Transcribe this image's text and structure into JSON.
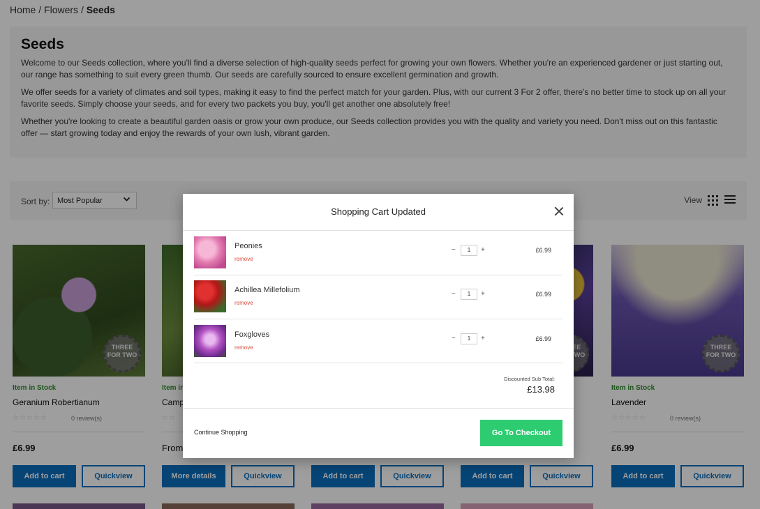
{
  "breadcrumb": {
    "home": "Home",
    "sep1": "/",
    "flowers": "Flowers",
    "sep2": "/",
    "current": "Seeds"
  },
  "intro": {
    "title": "Seeds",
    "paragraphs": [
      "Welcome to our Seeds collection, where you'll find a diverse selection of high-quality seeds perfect for growing your own flowers. Whether you're an experienced gardener or just starting out, our range has something to suit every green thumb. Our seeds are carefully sourced to ensure excellent germination and growth.",
      "We offer seeds for a variety of climates and soil types, making it easy to find the perfect match for your garden. Plus, with our current 3 For 2 offer, there's no better time to stock up on all your favorite seeds. Simply choose your seeds, and for every two packets you buy, you'll get another one absolutely free!",
      "Whether you're looking to create a beautiful garden oasis or grow your own produce, our Seeds collection provides you with the quality and variety you need. Don't miss out on this fantastic offer — start growing today and enjoy the rewards of your own lush, vibrant garden."
    ]
  },
  "toolbar": {
    "sort_label": "Sort by:",
    "sort_value": "Most Popular",
    "view_label": "View"
  },
  "products": [
    {
      "stock": "Item in Stock",
      "name": "Geranium Robertianum",
      "stars": "☆☆☆☆☆",
      "reviews": "0 review(s)",
      "price": "£6.99",
      "primary_btn": "Add to cart",
      "secondary_btn": "Quickview",
      "badge": "THREE FOR TWO"
    },
    {
      "stock": "Item in",
      "name": "Camp",
      "stars": "☆☆",
      "reviews": "",
      "price": "From",
      "primary_btn": "More details",
      "secondary_btn": "Quickview",
      "badge": ""
    },
    {
      "stock": "",
      "name": "",
      "stars": "",
      "reviews": "",
      "price": "",
      "primary_btn": "Add to cart",
      "secondary_btn": "Quickview",
      "badge": ""
    },
    {
      "stock": "",
      "name": "",
      "stars": "",
      "reviews": "",
      "price": "",
      "primary_btn": "Add to cart",
      "secondary_btn": "Quickview",
      "badge": "THREE FOR TWO"
    },
    {
      "stock": "Item in Stock",
      "name": "Lavender",
      "stars": "☆☆☆☆☆",
      "reviews": "0 review(s)",
      "price": "£6.99",
      "primary_btn": "Add to cart",
      "secondary_btn": "Quickview",
      "badge": "THREE FOR TWO"
    }
  ],
  "modal": {
    "title": "Shopping Cart Updated",
    "items": [
      {
        "name": "Peonies",
        "remove": "remove",
        "minus": "−",
        "qty": "1",
        "plus": "+",
        "price": "£6.99"
      },
      {
        "name": "Achillea Millefolium",
        "remove": "remove",
        "minus": "−",
        "qty": "1",
        "plus": "+",
        "price": "£6.99"
      },
      {
        "name": "Foxgloves",
        "remove": "remove",
        "minus": "−",
        "qty": "1",
        "plus": "+",
        "price": "£6.99"
      }
    ],
    "subtotal_label": "Discounted Sub Total:",
    "subtotal_value": "£13.98",
    "continue_label": "Continue Shopping",
    "checkout_label": "Go To Checkout"
  },
  "colors": {
    "primary": "#0a6ebd",
    "checkout": "#2ecc71",
    "stock": "#2e8b2e",
    "remove": "#e04b3c"
  }
}
